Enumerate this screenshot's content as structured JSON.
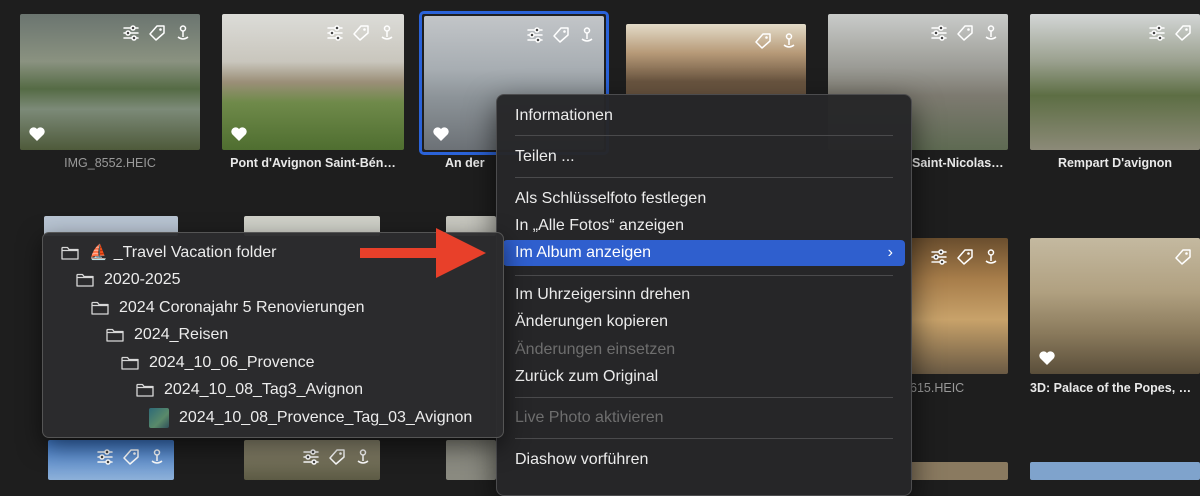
{
  "grid": {
    "row1": [
      {
        "caption": "IMG_8552.HEIC",
        "style": "plain",
        "favorite": true
      },
      {
        "caption": "Pont d'Avignon Saint-Bén…",
        "style": "bold",
        "favorite": true
      },
      {
        "caption": "An der",
        "style": "bold",
        "favorite": true,
        "selected": true
      },
      {
        "caption": "",
        "style": "bold",
        "favorite": false
      },
      {
        "caption": "Saint-Nicolas…",
        "style": "bold",
        "favorite": false
      },
      {
        "caption": "Rempart D'avignon",
        "style": "bold",
        "favorite": false
      }
    ],
    "row2": [
      {
        "caption": "615.HEIC",
        "style": "plain",
        "favorite": false
      },
      {
        "caption": "3D: Palace of the Popes, …",
        "style": "bold",
        "favorite": true
      }
    ]
  },
  "context_menu": {
    "items": [
      {
        "label": "Informationen",
        "disabled": false
      },
      {
        "label": "Teilen ...",
        "disabled": false
      },
      {
        "label": "Als Schlüsselfoto festlegen",
        "disabled": false
      },
      {
        "label": "In „Alle Fotos“ anzeigen",
        "disabled": false
      },
      {
        "label": "Im Album anzeigen",
        "disabled": false,
        "highlighted": true,
        "submenu": true
      },
      {
        "label": "Im Uhrzeigersinn drehen",
        "disabled": false
      },
      {
        "label": "Änderungen kopieren",
        "disabled": false
      },
      {
        "label": "Änderungen einsetzen",
        "disabled": true
      },
      {
        "label": "Zurück zum Original",
        "disabled": false
      },
      {
        "label": "Live Photo aktivieren",
        "disabled": true
      },
      {
        "label": "Diashow vorführen",
        "disabled": false
      }
    ],
    "chevron": "›"
  },
  "submenu": {
    "items": [
      {
        "label": "_Travel Vacation folder",
        "icon": "folder-icon",
        "emoji": "⛵"
      },
      {
        "label": "2020-2025",
        "icon": "folder-icon"
      },
      {
        "label": "2024 Coronajahr 5 Renovierungen",
        "icon": "folder-icon"
      },
      {
        "label": "2024_Reisen",
        "icon": "folder-icon"
      },
      {
        "label": "2024_10_06_Provence",
        "icon": "folder-icon"
      },
      {
        "label": "2024_10_08_Tag3_Avignon",
        "icon": "folder-icon"
      },
      {
        "label": "2024_10_08_Provence_Tag_03_Avignon",
        "icon": "album-thumbnail"
      }
    ]
  },
  "colors": {
    "selection": "#2b63d9",
    "menu_highlight": "#2f5fce",
    "arrow": "#e8402a"
  }
}
